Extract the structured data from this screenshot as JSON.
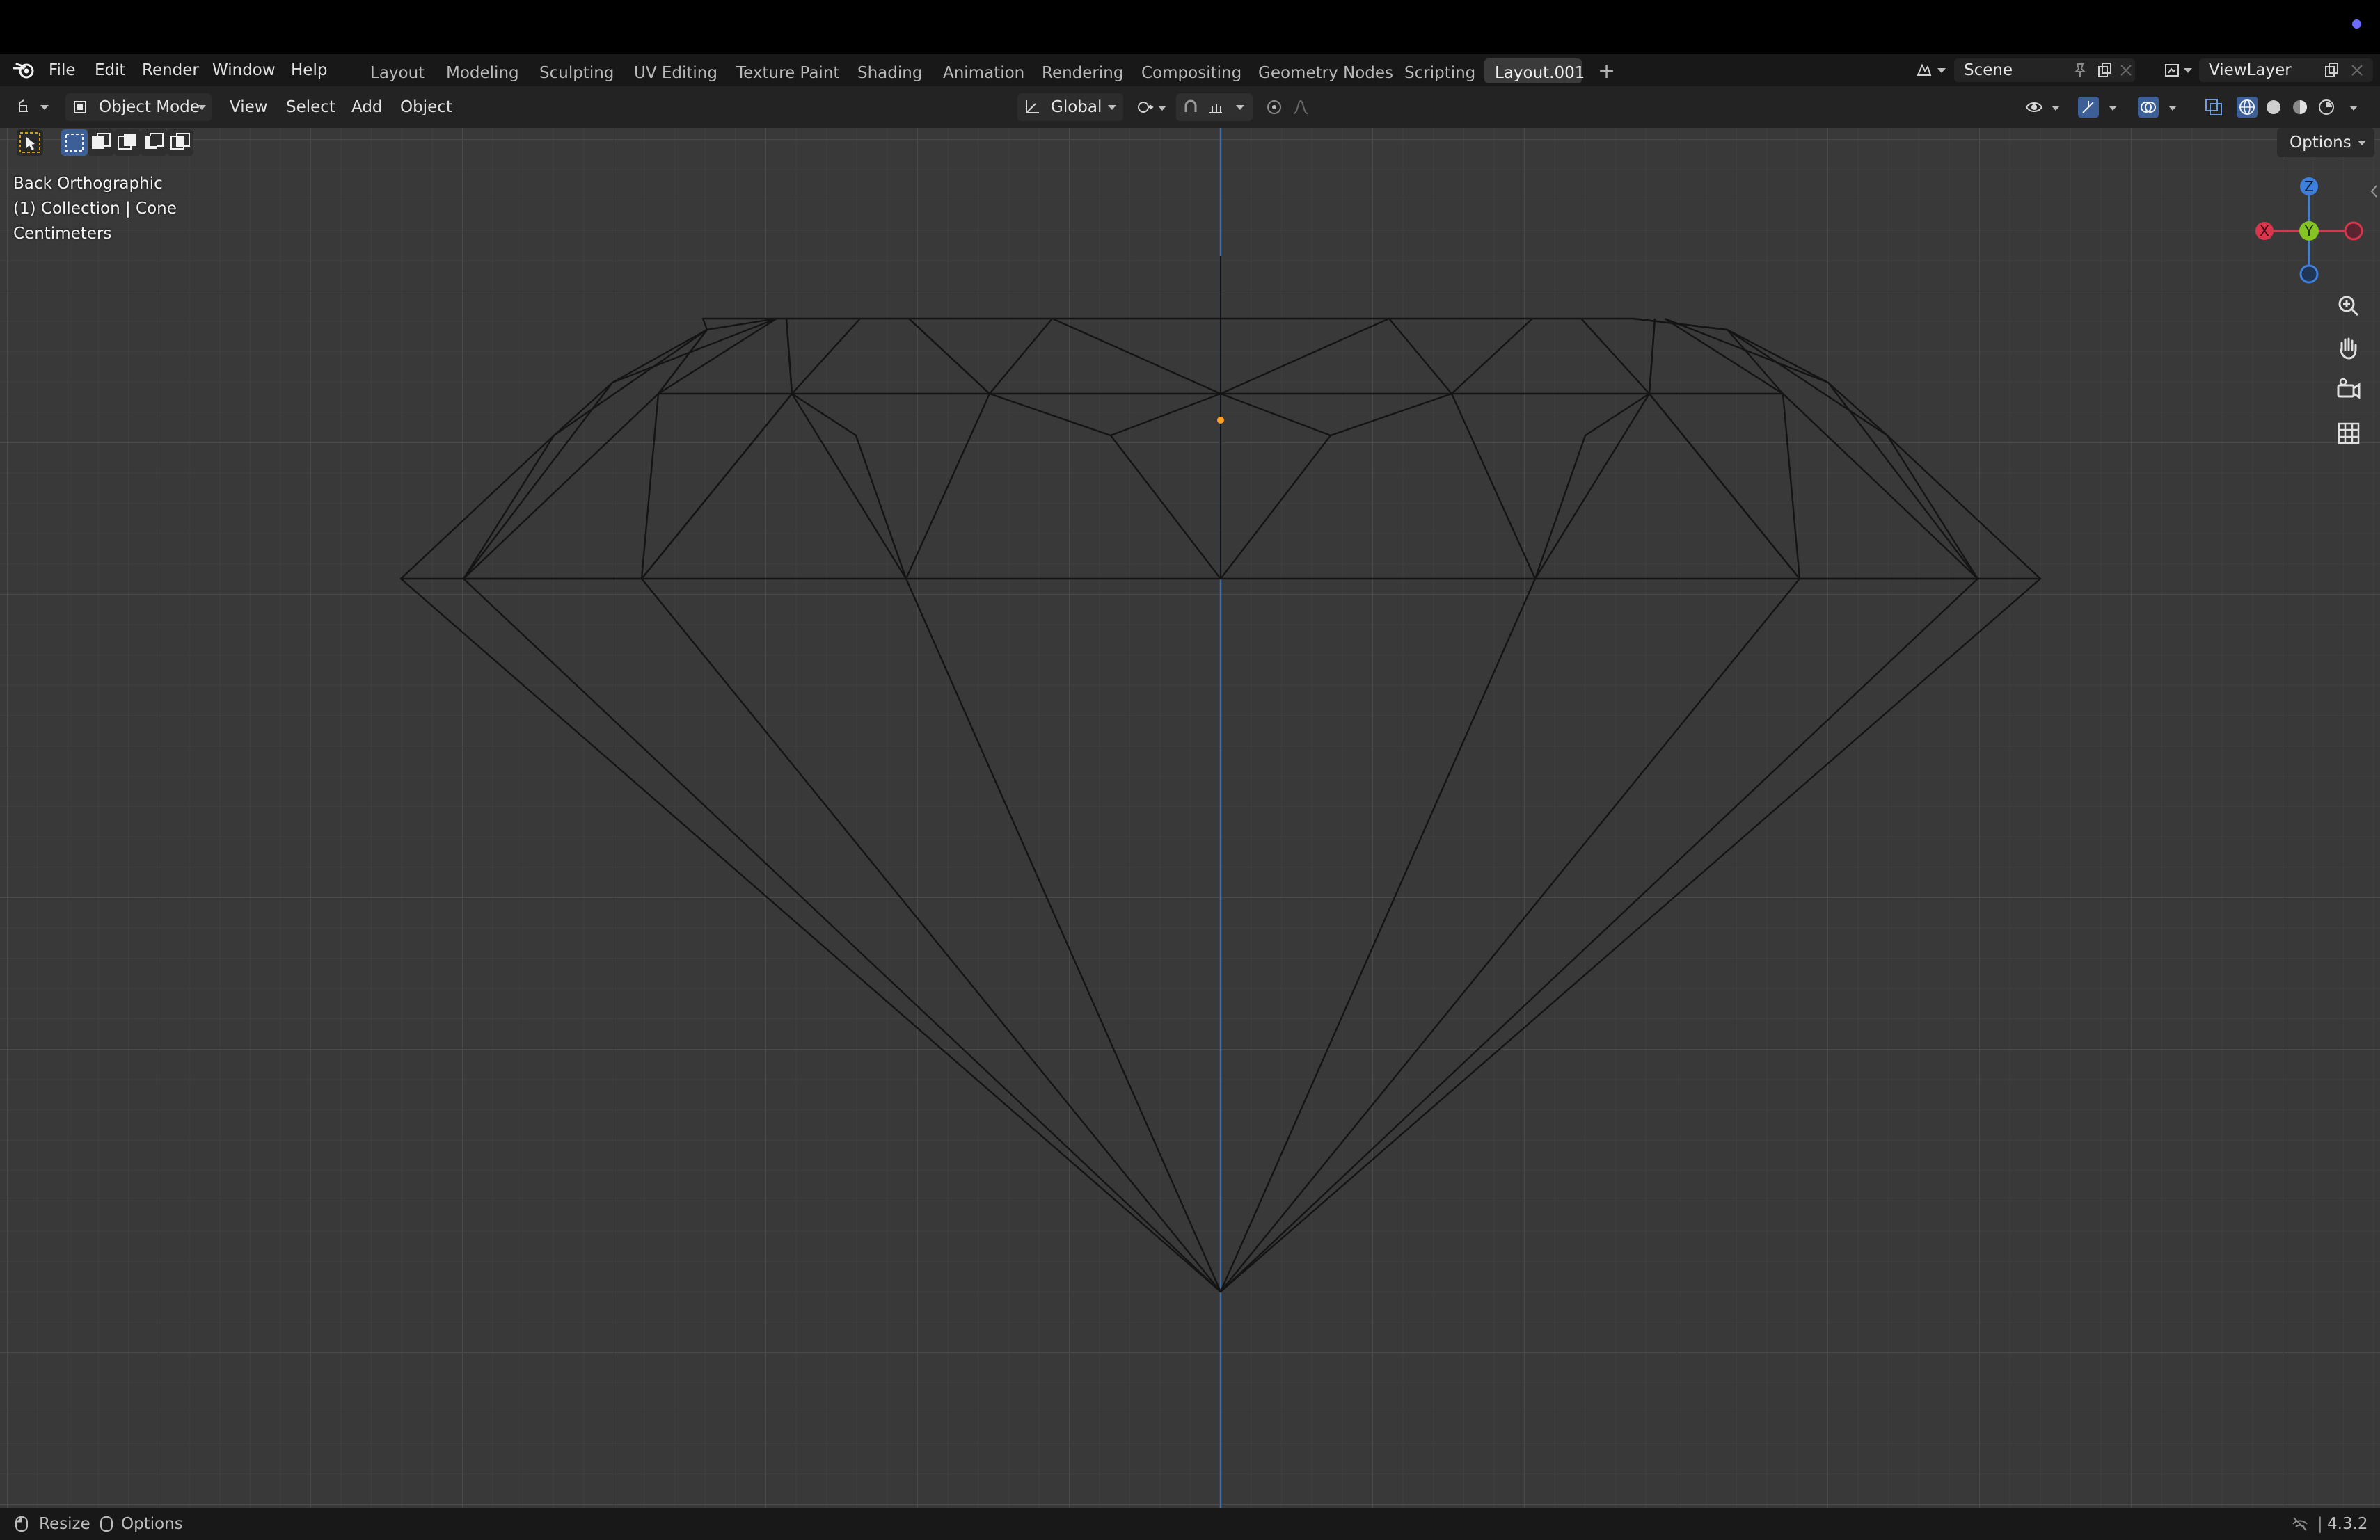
{
  "menubar": {
    "items": [
      "File",
      "Edit",
      "Render",
      "Window",
      "Help"
    ],
    "workspaces": [
      "Layout",
      "Modeling",
      "Sculpting",
      "UV Editing",
      "Texture Paint",
      "Shading",
      "Animation",
      "Rendering",
      "Compositing",
      "Geometry Nodes",
      "Scripting",
      "Layout.001"
    ],
    "active_workspace": "Layout.001",
    "add_tab_symbol": "+",
    "scene": "Scene",
    "view_layer": "ViewLayer"
  },
  "header": {
    "mode": "Object Mode",
    "menus": [
      "View",
      "Select",
      "Add",
      "Object"
    ],
    "transform_orientation": "Global",
    "options_label": "Options"
  },
  "viewport": {
    "view_name": "Back Orthographic",
    "collection_info": "(1) Collection | Cone",
    "units": "Centimeters",
    "background_color": "#393939",
    "wire_color": "#141414",
    "axis_color": "#3d6fa8"
  },
  "gizmo": {
    "z_label": "Z",
    "y_label": "Y",
    "x_label": "X",
    "colors": {
      "x": "#d9364d",
      "y": "#86c425",
      "z": "#3d7fdc"
    }
  },
  "icons": [
    "blender-logo-icon",
    "editor-type-icon",
    "object-mode-icon",
    "transform-orientation-icon",
    "snap-icon",
    "proportional-edit-icon",
    "visibility-icon",
    "gizmo-icon",
    "overlay-icon",
    "xray-icon",
    "wireframe-shading-icon",
    "solid-shading-icon",
    "material-shading-icon",
    "rendered-shading-icon",
    "zoom-icon",
    "hand-pan-icon",
    "camera-icon",
    "grid-icon"
  ],
  "statusbar": {
    "left": [
      "Resize",
      "Options"
    ],
    "version": "4.3.2"
  }
}
